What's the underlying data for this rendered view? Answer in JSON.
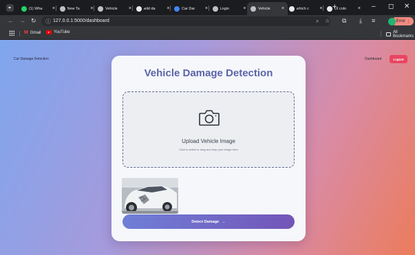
{
  "browser": {
    "tabs": [
      {
        "title": "(1) Wha",
        "favicon_color": "#25d366"
      },
      {
        "title": "New Ta",
        "favicon_color": "#bdc1c6"
      },
      {
        "title": "Vehicle",
        "favicon_color": "#bdc1c6"
      },
      {
        "title": "wild da",
        "favicon_color": "#e8eaed"
      },
      {
        "title": "Car Dar",
        "favicon_color": "#4285f4"
      },
      {
        "title": "Login",
        "favicon_color": "#bdc1c6"
      },
      {
        "title": "Vehicle",
        "favicon_color": "#bdc1c6"
      },
      {
        "title": "which c",
        "favicon_color": "#e8eaed"
      },
      {
        "title": "UI colo",
        "favicon_color": "#e8eaed"
      }
    ],
    "active_tab_index": 6,
    "close_glyph": "×",
    "new_tab_glyph": "+",
    "url": "127.0.0.1:5000/dashboard",
    "error_label": "Error",
    "bookmarks": {
      "gmail": "Gmail",
      "youtube": "YouTube",
      "all_bookmarks": "All Bookmarks"
    }
  },
  "page": {
    "brand": "Car Damage Detection",
    "nav_dashboard": "Dashboard",
    "logout_label": "Logout",
    "title": "Vehicle Damage Detection",
    "upload_title": "Upload Vehicle Image",
    "upload_hint": "Click to select or drag and drop your image here",
    "detect_label": "Detect Damage",
    "detect_arrow": "→"
  },
  "colors": {
    "accent_start": "#6f7fd6",
    "accent_end": "#7355b8",
    "logout": "#e84560",
    "title": "#5a64a8"
  }
}
